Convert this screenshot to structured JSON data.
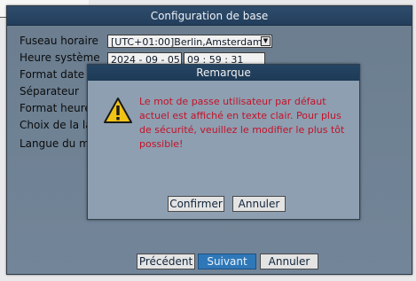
{
  "window": {
    "title": "Configuration de base"
  },
  "settings": {
    "timezone_label": "Fuseau horaire",
    "timezone_value": "[UTC+01:00]Berlin,Amsterdam",
    "system_time_label": "Heure système",
    "system_date_value": "2024 - 09 - 05",
    "system_clock_value": "09 : 59 : 31",
    "date_format_label": "Format date",
    "separator_label": "Séparateur",
    "time_format_label": "Format heure",
    "language_choice_label": "Choix de la lar",
    "menu_language_label": "Langue du me"
  },
  "remark": {
    "title": "Remarque",
    "message": "Le mot de passe utilisateur par défaut actuel est affiché en texte clair. Pour plus de sécurité, veuillez le modifier le plus tôt possible!",
    "confirm_label": "Confirmer",
    "cancel_label": "Annuler"
  },
  "footer": {
    "previous_label": "Précédent",
    "next_label": "Suivant",
    "cancel_label": "Annuler"
  },
  "icons": {
    "warning": "warning-icon",
    "dropdown": "chevron-down-icon"
  },
  "colors": {
    "title_bar": "#233e5c",
    "message_text": "#c4122a",
    "primary_button": "#2f78b8",
    "warning_fill": "#f2c317"
  }
}
